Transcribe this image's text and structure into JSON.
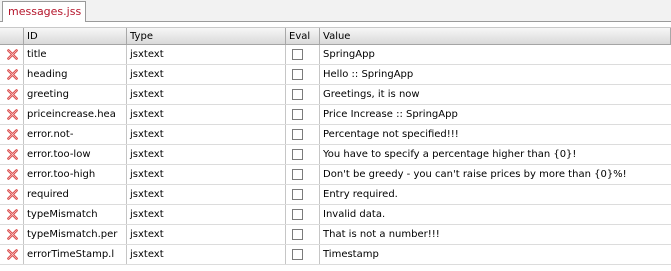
{
  "tab": {
    "label": "messages.jss"
  },
  "columns": {
    "id": "ID",
    "type": "Type",
    "eval": "Eval",
    "value": "Value"
  },
  "rows": [
    {
      "id": "title",
      "type": "jsxtext",
      "eval": false,
      "value": "SpringApp"
    },
    {
      "id": "heading",
      "type": "jsxtext",
      "eval": false,
      "value": "Hello :: SpringApp"
    },
    {
      "id": "greeting",
      "type": "jsxtext",
      "eval": false,
      "value": "Greetings, it is now"
    },
    {
      "id": "priceincrease.hea",
      "type": "jsxtext",
      "eval": false,
      "value": "Price Increase :: SpringApp"
    },
    {
      "id": "error.not-",
      "type": "jsxtext",
      "eval": false,
      "value": "Percentage not specified!!!"
    },
    {
      "id": "error.too-low",
      "type": "jsxtext",
      "eval": false,
      "value": "You have to specify a percentage higher than {0}!"
    },
    {
      "id": "error.too-high",
      "type": "jsxtext",
      "eval": false,
      "value": "Don't be greedy - you can't raise prices by more than {0}%!"
    },
    {
      "id": "required",
      "type": "jsxtext",
      "eval": false,
      "value": "Entry required."
    },
    {
      "id": "typeMismatch",
      "type": "jsxtext",
      "eval": false,
      "value": "Invalid data."
    },
    {
      "id": "typeMismatch.per",
      "type": "jsxtext",
      "eval": false,
      "value": "That is not a number!!!"
    },
    {
      "id": "errorTimeStamp.l",
      "type": "jsxtext",
      "eval": false,
      "value": "Timestamp"
    }
  ],
  "icons": {
    "delete": "delete-x-icon"
  },
  "colors": {
    "tab_text": "#b5152b",
    "delete_icon": "#d84040"
  }
}
